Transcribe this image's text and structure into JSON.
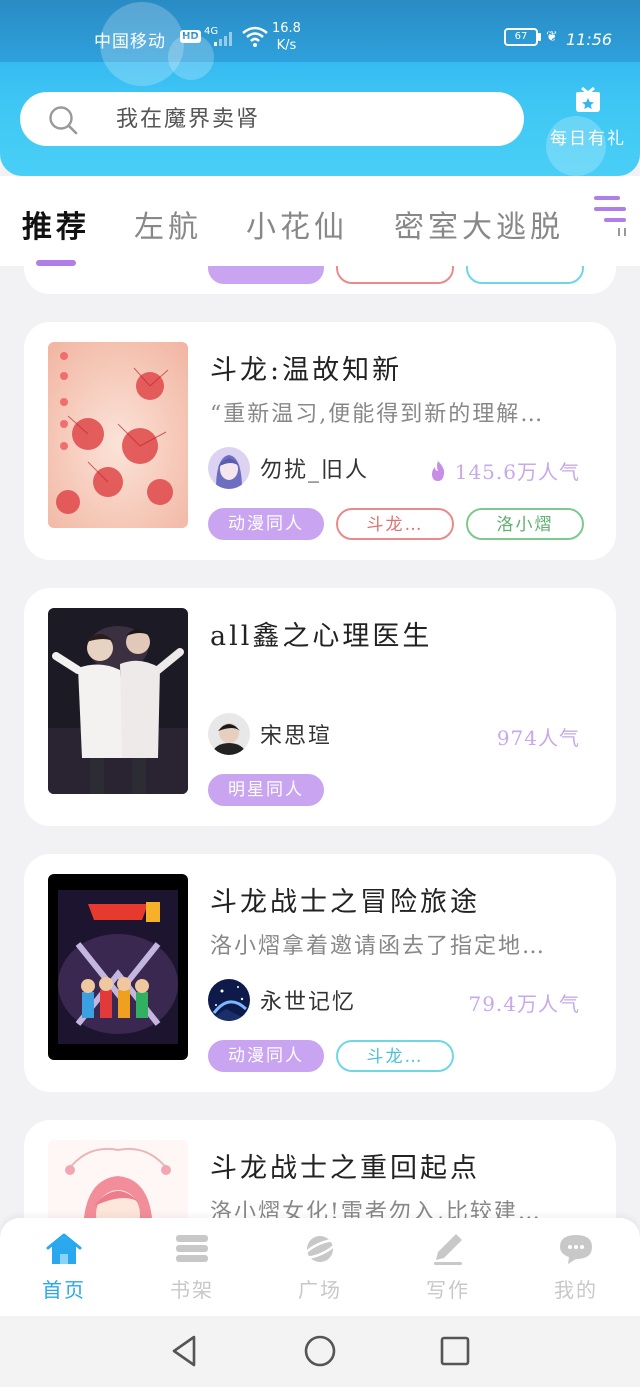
{
  "status": {
    "carrier": "中国移动",
    "hd": "HD",
    "network": "4G",
    "speed_value": "16.8",
    "speed_unit": "K/s",
    "battery": "67",
    "time": "11:56"
  },
  "search": {
    "placeholder": "我在魔界卖肾"
  },
  "daily_gift": {
    "label": "每日有礼",
    "icon": "gift-icon"
  },
  "tabs": [
    {
      "label": "推荐",
      "active": true
    },
    {
      "label": "左航"
    },
    {
      "label": "小花仙"
    },
    {
      "label": "密室大逃脱"
    }
  ],
  "cards": [
    {
      "title": "斗龙:温故知新",
      "desc": "“重新温习,便能得到新的理解…",
      "author": "勿扰_旧人",
      "popularity": "145.6万人气",
      "tags": [
        "动漫同人",
        "斗龙…",
        "洛小熠"
      ]
    },
    {
      "title": "all鑫之心理医生",
      "desc": "",
      "author": "宋思瑄",
      "popularity": "974人气",
      "tags": [
        "明星同人"
      ]
    },
    {
      "title": "斗龙战士之冒险旅途",
      "desc": "洛小熠拿着邀请函去了指定地…",
      "author": "永世记忆",
      "popularity": "79.4万人气",
      "tags": [
        "动漫同人",
        "斗龙…"
      ]
    },
    {
      "title": "斗龙战士之重回起点",
      "desc": "洛小熠女化!雷者勿入,比较建…",
      "author": "",
      "popularity": "",
      "tags": []
    }
  ],
  "bottom_nav": [
    {
      "label": "首页",
      "icon": "home-icon",
      "active": true
    },
    {
      "label": "书架",
      "icon": "bookshelf-icon"
    },
    {
      "label": "广场",
      "icon": "planet-icon"
    },
    {
      "label": "写作",
      "icon": "pen-icon"
    },
    {
      "label": "我的",
      "icon": "chat-bubble-icon"
    }
  ],
  "colors": {
    "header_blue": "#2aa8ee",
    "accent_purple": "#c9a4f0",
    "popularity_purple": "#c8a8ea"
  }
}
